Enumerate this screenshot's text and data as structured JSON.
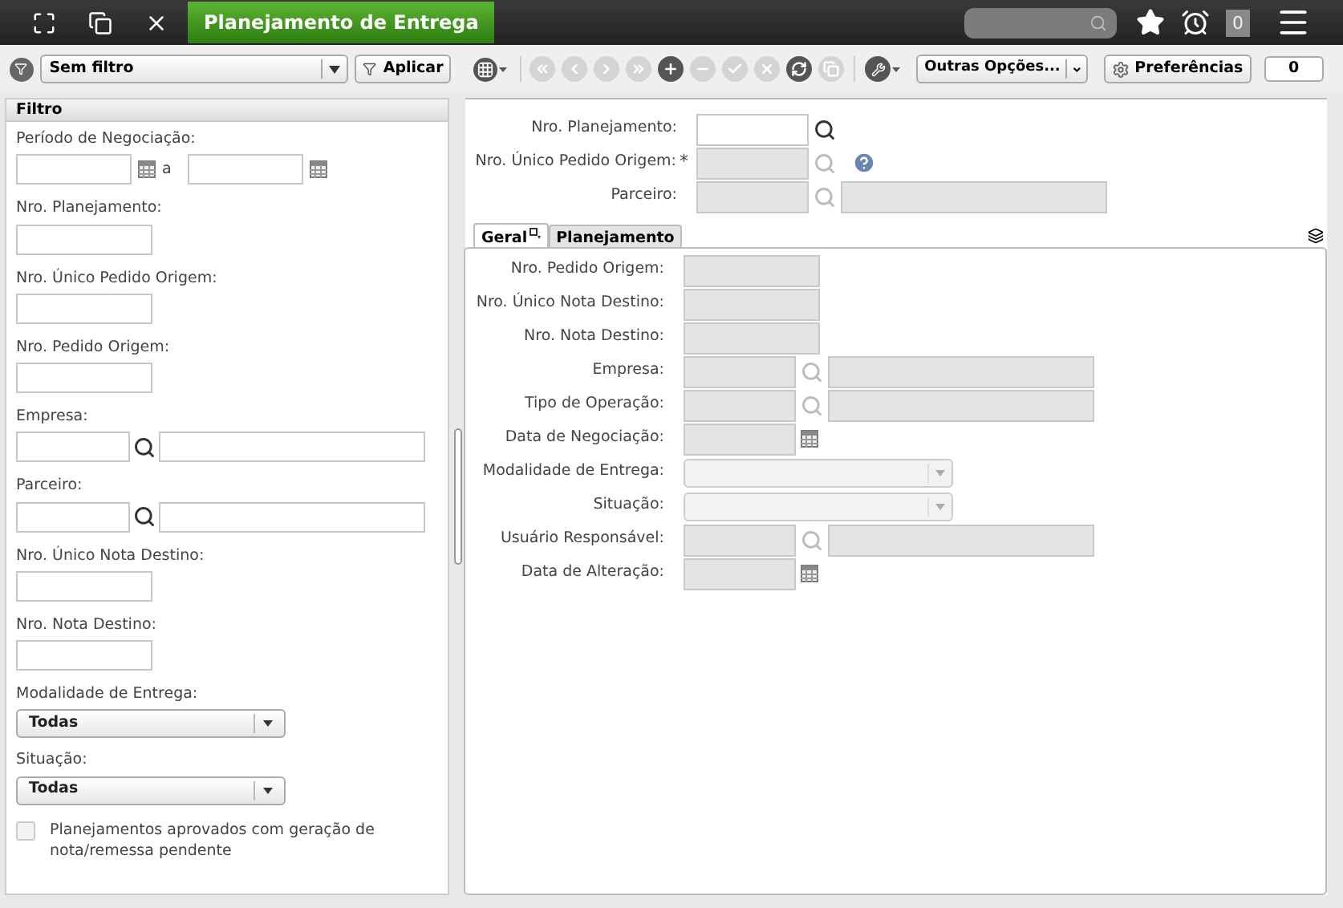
{
  "top_bar": {
    "title": "Planejamento de Entrega",
    "notification_count": "0"
  },
  "filter_bar": {
    "filter": "Sem filtro",
    "apply": "Aplicar"
  },
  "toolbar": {
    "buttons": [
      {
        "kind": "first",
        "disabled": true
      },
      {
        "kind": "prev",
        "disabled": true
      },
      {
        "kind": "next",
        "disabled": true
      },
      {
        "kind": "last",
        "disabled": true
      },
      {
        "kind": "add",
        "disabled": false
      },
      {
        "kind": "remove",
        "disabled": true
      },
      {
        "kind": "confirm",
        "disabled": true
      },
      {
        "kind": "cancel",
        "disabled": true
      },
      {
        "kind": "refresh",
        "disabled": false
      },
      {
        "kind": "copy",
        "disabled": true
      }
    ],
    "more": "Outras Opções...",
    "preferences": "Preferências",
    "counter": "0"
  },
  "filter_panel": {
    "title": "Filtro",
    "fields": [
      {
        "kind": "date_range",
        "label": "Período de Negociação:",
        "separator": "a"
      },
      {
        "kind": "text",
        "label": "Nro. Planejamento:"
      },
      {
        "kind": "text",
        "label": "Nro. Único Pedido Origem:"
      },
      {
        "kind": "text",
        "label": "Nro. Pedido Origem:"
      },
      {
        "kind": "lookup",
        "label": "Empresa:"
      },
      {
        "kind": "lookup",
        "label": "Parceiro:"
      },
      {
        "kind": "text",
        "label": "Nro. Único Nota Destino:"
      },
      {
        "kind": "text",
        "label": "Nro. Nota Destino:"
      },
      {
        "kind": "select",
        "label": "Modalidade de Entrega:",
        "value": "Todas"
      },
      {
        "kind": "select",
        "label": "Situação:",
        "value": "Todas"
      }
    ],
    "checkbox": {
      "label": "Planejamentos aprovados com geração de nota/remessa pendente",
      "checked": false
    }
  },
  "header_form": [
    {
      "kind": "lookup",
      "label": "Nro. Planejamento:",
      "disabled": false
    },
    {
      "kind": "lookup",
      "label": "Nro. Único Pedido Origem:",
      "disabled": true,
      "required_mark": "*",
      "help": true
    },
    {
      "kind": "lookup_desc",
      "label": "Parceiro:",
      "disabled": true
    }
  ],
  "tabs": [
    {
      "label": "Geral",
      "selected": true
    },
    {
      "label": "Planejamento",
      "selected": false
    }
  ],
  "tab_form": [
    {
      "kind": "text",
      "label": "Nro. Pedido Origem:",
      "disabled": true
    },
    {
      "kind": "text",
      "label": "Nro. Único Nota Destino:",
      "disabled": true
    },
    {
      "kind": "text",
      "label": "Nro. Nota Destino:",
      "disabled": true
    },
    {
      "kind": "lookup_desc",
      "label": "Empresa:",
      "disabled": true
    },
    {
      "kind": "lookup_desc",
      "label": "Tipo de Operação:",
      "disabled": true
    },
    {
      "kind": "date",
      "label": "Data de Negociação:",
      "disabled": true
    },
    {
      "kind": "select",
      "label": "Modalidade de Entrega:",
      "disabled": true
    },
    {
      "kind": "select",
      "label": "Situação:",
      "disabled": true
    },
    {
      "kind": "lookup_desc",
      "label": "Usuário Responsável:",
      "disabled": true
    },
    {
      "kind": "date",
      "label": "Data de Alteração:",
      "disabled": true
    }
  ]
}
